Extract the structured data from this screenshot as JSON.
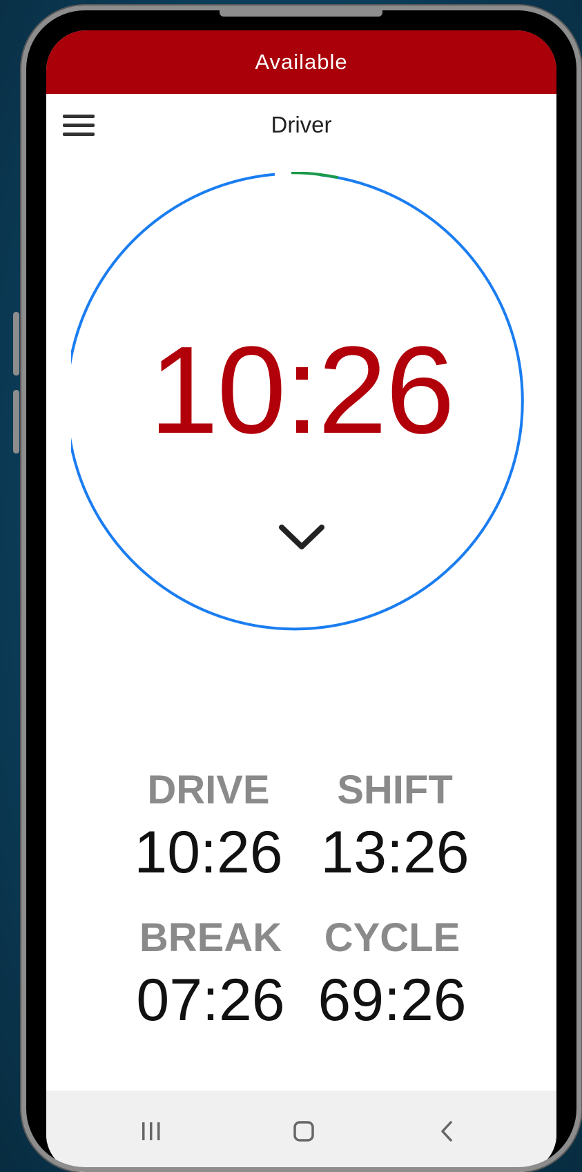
{
  "status": {
    "text": "Available",
    "color": "#a9000a"
  },
  "header": {
    "title": "Driver",
    "menu_icon": "hamburger-menu-icon"
  },
  "dial": {
    "remaining": "10:26",
    "ring_color": "#1a7df0",
    "accent_arc_color": "#1a9a4a",
    "expand_icon": "chevron-down-icon"
  },
  "clocks": [
    {
      "label": "DRIVE",
      "value": "10:26"
    },
    {
      "label": "SHIFT",
      "value": "13:26"
    },
    {
      "label": "BREAK",
      "value": "07:26"
    },
    {
      "label": "CYCLE",
      "value": "69:26"
    }
  ],
  "navbar": {
    "recents_icon": "recent-apps-icon",
    "home_icon": "home-icon",
    "back_icon": "back-icon"
  }
}
